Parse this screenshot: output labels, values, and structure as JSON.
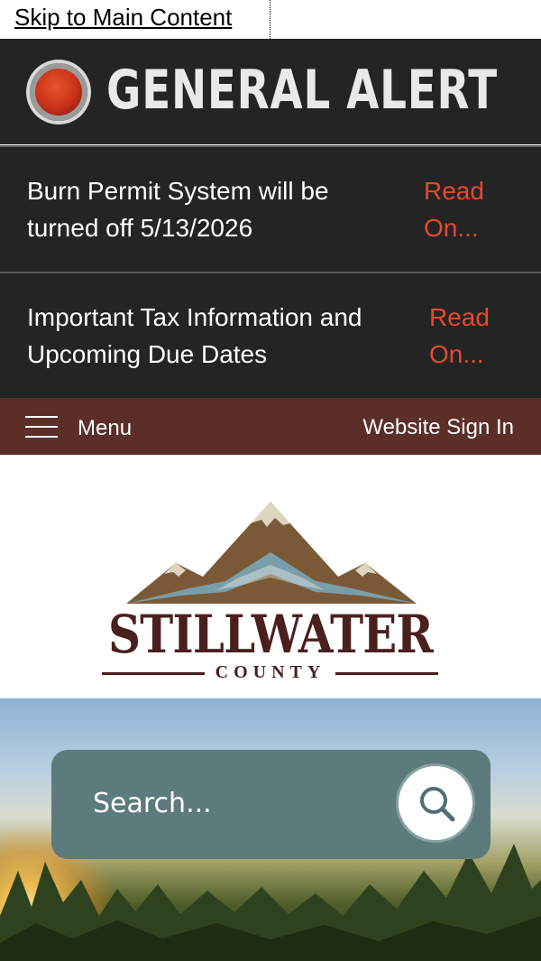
{
  "skip_link": "Skip to Main Content",
  "alert": {
    "title": "GENERAL ALERT",
    "items": [
      {
        "text": "Burn Permit System will be turned off 5/13/2026",
        "link": "Read On..."
      },
      {
        "text": "Important Tax Information and Upcoming Due Dates",
        "link": "Read On..."
      }
    ]
  },
  "nav": {
    "menu_label": "Menu",
    "sign_in": "Website Sign In"
  },
  "logo": {
    "name": "STILLWATER",
    "county": "COUNTY"
  },
  "search": {
    "placeholder": "Search..."
  },
  "colors": {
    "alert_bg": "#242424",
    "alert_link": "#e64a2e",
    "nav_bg": "#5b2f28",
    "brand": "#4b1f1f",
    "search_bg": "#5d7a7c"
  }
}
